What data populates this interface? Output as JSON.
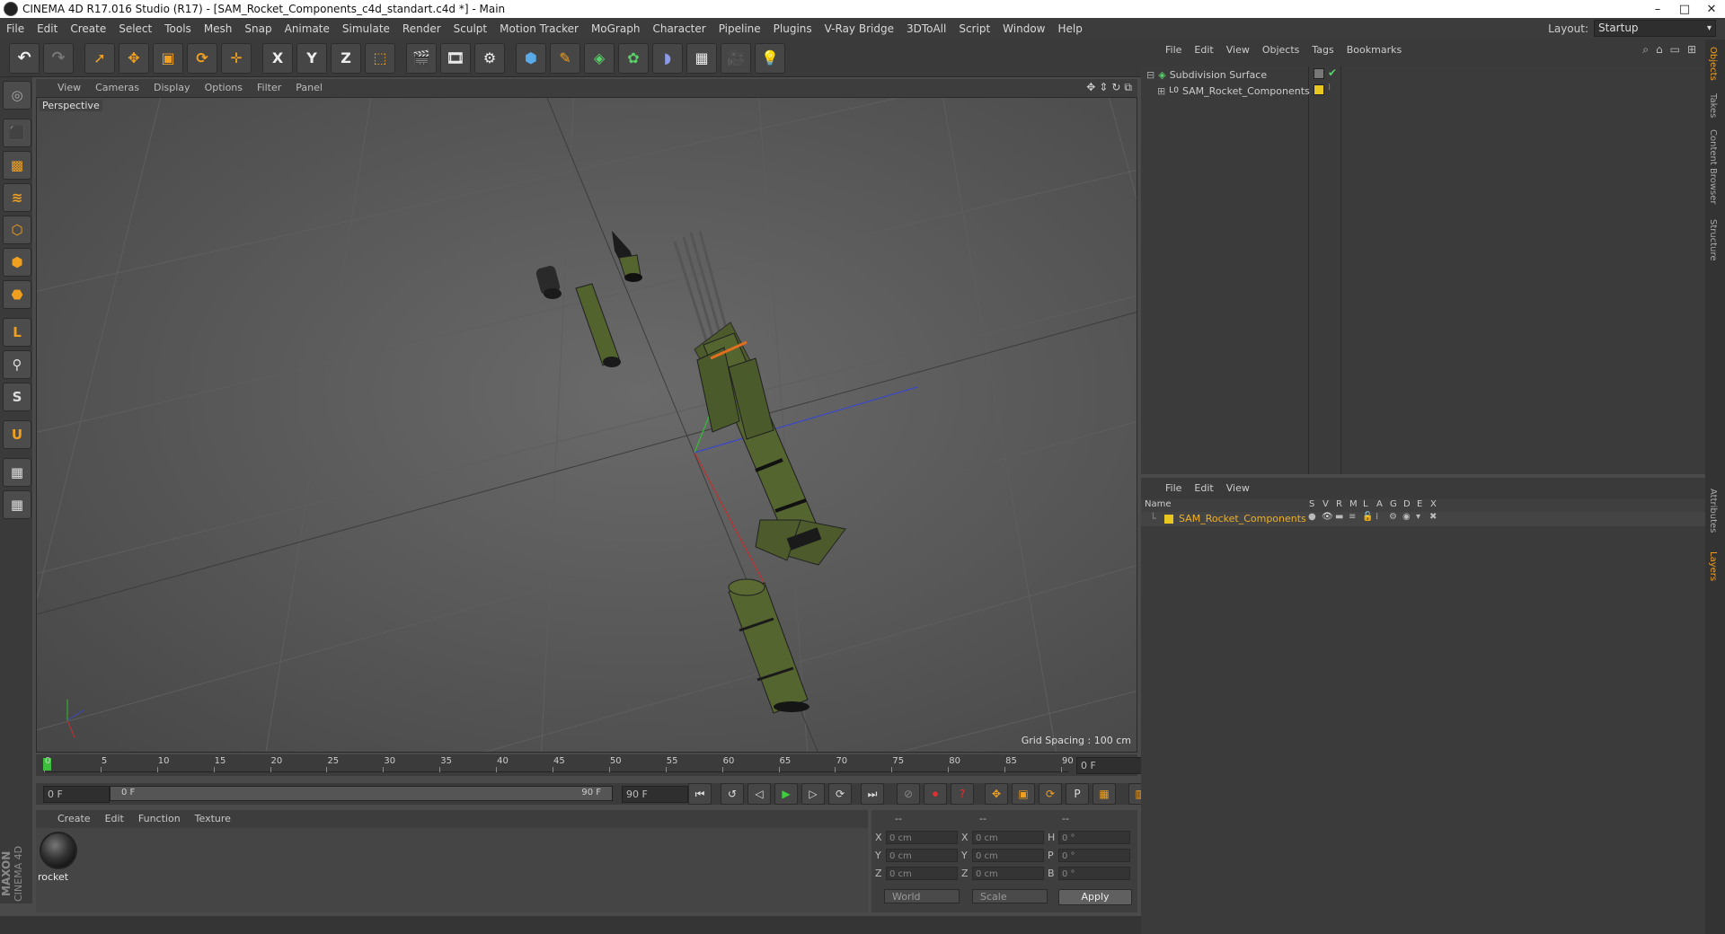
{
  "window": {
    "title": "CINEMA 4D R17.016 Studio (R17) - [SAM_Rocket_Components_c4d_standart.c4d *] - Main"
  },
  "menubar": {
    "items": [
      "File",
      "Edit",
      "Create",
      "Select",
      "Tools",
      "Mesh",
      "Snap",
      "Animate",
      "Simulate",
      "Render",
      "Sculpt",
      "Motion Tracker",
      "MoGraph",
      "Character",
      "Pipeline",
      "Plugins",
      "V-Ray Bridge",
      "3DToAll",
      "Script",
      "Window",
      "Help"
    ],
    "layout_label": "Layout:",
    "layout_value": "Startup"
  },
  "toolbar": {
    "axis_x": "X",
    "axis_y": "Y",
    "axis_z": "Z"
  },
  "viewport": {
    "menu": [
      "View",
      "Cameras",
      "Display",
      "Options",
      "Filter",
      "Panel"
    ],
    "camera_label": "Perspective",
    "grid_spacing": "Grid Spacing : 100 cm"
  },
  "timeline": {
    "ticks": [
      "0",
      "5",
      "10",
      "15",
      "20",
      "25",
      "30",
      "35",
      "40",
      "45",
      "50",
      "55",
      "60",
      "65",
      "70",
      "75",
      "80",
      "85",
      "90"
    ],
    "current_frame": "0 F",
    "start_frame": "0 F",
    "range_start": "0 F",
    "range_end": "90 F",
    "end_frame": "90 F"
  },
  "material_manager": {
    "menu": [
      "Create",
      "Edit",
      "Function",
      "Texture"
    ],
    "material_name": "rocket"
  },
  "coordinates": {
    "headers": [
      "--",
      "--",
      "--"
    ],
    "rows": [
      {
        "l1": "X",
        "v1": "0 cm",
        "l2": "X",
        "v2": "0 cm",
        "l3": "H",
        "v3": "0 °"
      },
      {
        "l1": "Y",
        "v1": "0 cm",
        "l2": "Y",
        "v2": "0 cm",
        "l3": "P",
        "v3": "0 °"
      },
      {
        "l1": "Z",
        "v1": "0 cm",
        "l2": "Z",
        "v2": "0 cm",
        "l3": "B",
        "v3": "0 °"
      }
    ],
    "mode": "World",
    "type": "Scale",
    "apply_label": "Apply"
  },
  "object_manager": {
    "menu": [
      "File",
      "Edit",
      "View",
      "Objects",
      "Tags",
      "Bookmarks"
    ],
    "objects": [
      {
        "name": "Subdivision Surface"
      },
      {
        "name": "SAM_Rocket_Components"
      }
    ]
  },
  "layer_manager": {
    "menu": [
      "File",
      "Edit",
      "View"
    ],
    "columns": {
      "name": "Name",
      "flags": [
        "S",
        "V",
        "R",
        "M",
        "L",
        "A",
        "G",
        "D",
        "E",
        "X"
      ]
    },
    "layers": [
      {
        "name": "SAM_Rocket_Components",
        "color": "#e8c820"
      }
    ]
  },
  "right_tabs": [
    "Objects",
    "Takes",
    "Content Browser",
    "Structure",
    "Attributes",
    "Layers"
  ],
  "branding": {
    "maxon": "MAXON",
    "product": "CINEMA 4D"
  },
  "colors": {
    "accent": "#f0a020",
    "layer_text": "#f0b020",
    "object_green": "#4a5a2a"
  }
}
